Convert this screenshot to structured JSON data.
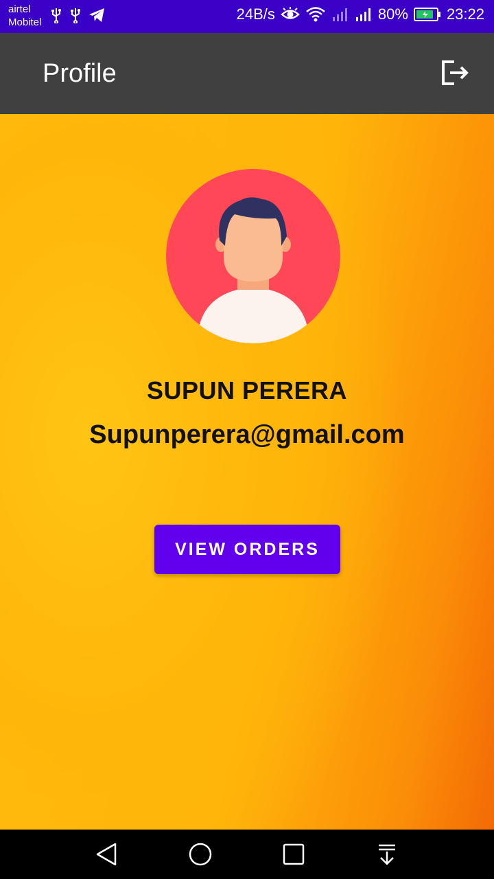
{
  "status_bar": {
    "carrier_1": "airtel",
    "carrier_2": "Mobitel",
    "net_speed": "24B/s",
    "battery": "80%",
    "time": "23:22",
    "icons": [
      "usb-icon",
      "usb-icon",
      "telegram-icon",
      "eye-icon",
      "wifi-icon",
      "signal-icon",
      "signal-icon",
      "battery-icon"
    ]
  },
  "app_bar": {
    "title": "Profile",
    "action_icon": "logout-icon"
  },
  "profile": {
    "avatar_icon": "avatar-icon",
    "name": "SUPUN PERERA",
    "email": "Supunperera@gmail.com",
    "view_orders_label": "VIEW ORDERS"
  },
  "nav_bar": {
    "buttons": [
      "back-icon",
      "home-icon",
      "recents-icon",
      "notification-pull-icon"
    ]
  },
  "colors": {
    "status_bar": "#3a00c8",
    "app_bar": "#404040",
    "accent": "#6200ee",
    "avatar_bg": "#ff4757"
  }
}
